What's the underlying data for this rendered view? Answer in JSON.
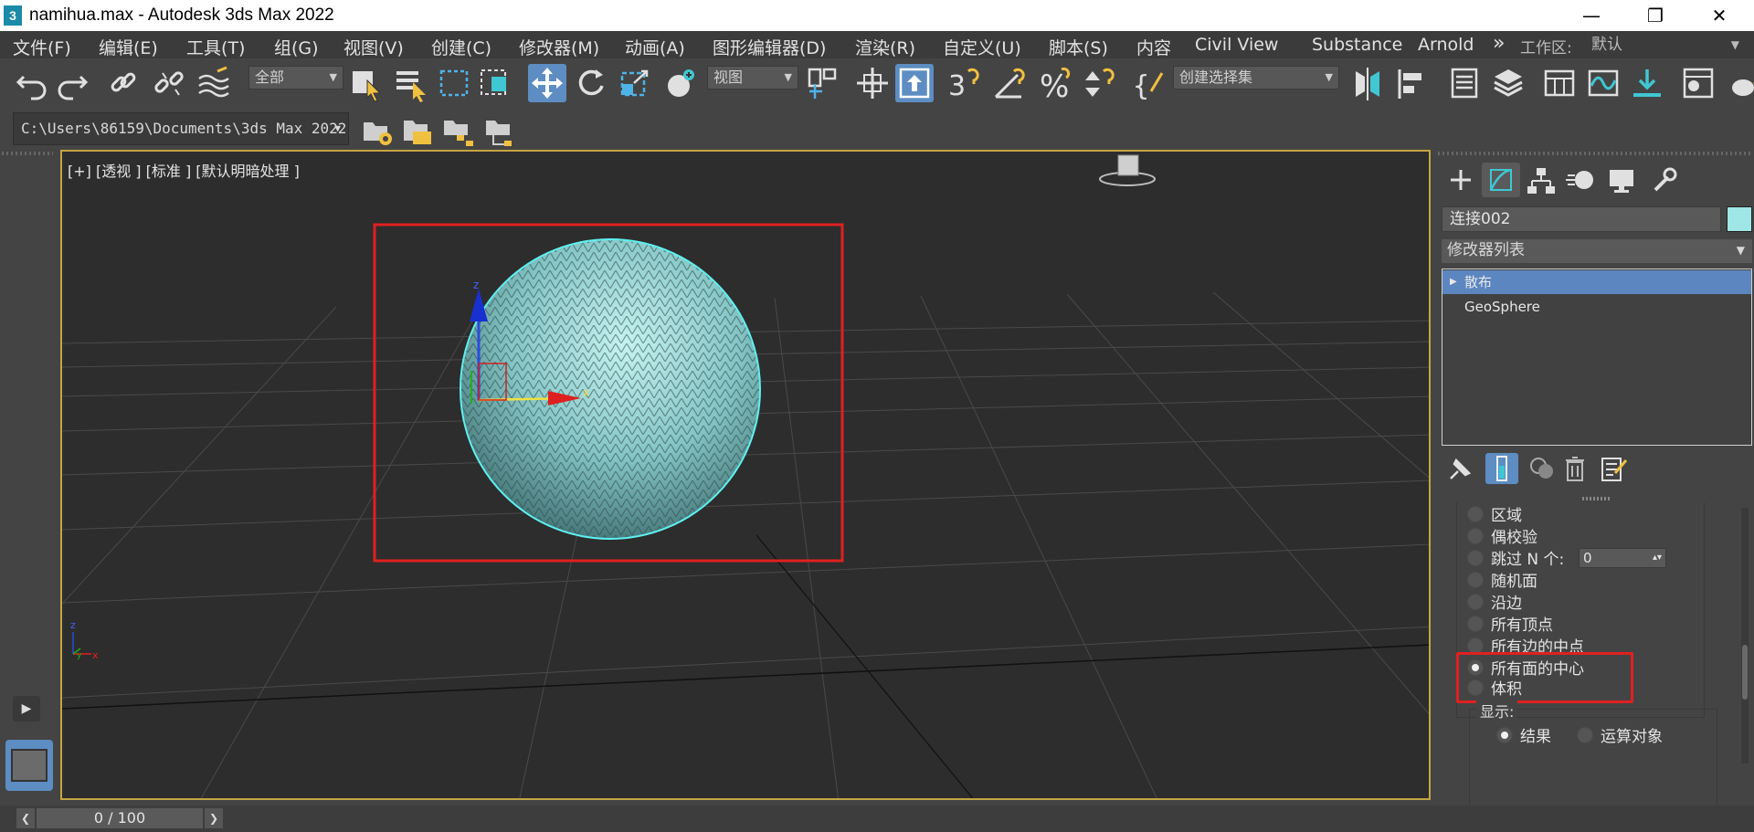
{
  "window": {
    "title": "namihua.max - Autodesk 3ds Max 2022",
    "app_logo": "3",
    "minimize_glyph": "—",
    "maximize_glyph": "❐",
    "close_glyph": "✕"
  },
  "menu": {
    "items": [
      "文件(F)",
      "编辑(E)",
      "工具(T)",
      "组(G)",
      "视图(V)",
      "创建(C)",
      "修改器(M)",
      "动画(A)",
      "图形编辑器(D)",
      "渲染(R)",
      "自定义(U)",
      "脚本(S)",
      "内容",
      "Civil View",
      "Substance",
      "Arnold"
    ],
    "more_glyph": "»",
    "workspace_label": "工作区:",
    "workspace_value": "默认"
  },
  "toolbar": {
    "selection_filter": "全部",
    "reference_coord": "视图",
    "angle_snap_label": "3",
    "named_selection_placeholder": "创建选择集"
  },
  "project_path": "C:\\Users\\86159\\Documents\\3ds Max 2022",
  "viewport": {
    "label": "[+] [透视 ] [标准 ] [默认明暗处理 ]",
    "selected_object_color": "#9fe6e6",
    "highlight_color": "#e02020",
    "axis_x": "x",
    "axis_y": "y",
    "axis_z": "z"
  },
  "command_panel": {
    "object_name": "连接002",
    "object_color": "#9fe6e6",
    "modifier_list_label": "修改器列表",
    "stack": [
      {
        "name": "散布",
        "selected": true
      },
      {
        "name": "GeoSphere",
        "selected": false
      }
    ],
    "distribution_options": [
      {
        "label": "区域",
        "selected": false
      },
      {
        "label": "偶校验",
        "selected": false
      },
      {
        "label": "跳过 N 个:",
        "selected": false
      },
      {
        "label": "随机面",
        "selected": false
      },
      {
        "label": "沿边",
        "selected": false
      },
      {
        "label": "所有顶点",
        "selected": false
      },
      {
        "label": "所有边的中点",
        "selected": false
      },
      {
        "label": "所有面的中心",
        "selected": true
      },
      {
        "label": "体积",
        "selected": false
      }
    ],
    "skip_n_value": "0",
    "display_label": "显示:",
    "display_options": [
      {
        "label": "结果",
        "selected": true
      },
      {
        "label": "运算对象",
        "selected": false
      }
    ]
  },
  "timeline": {
    "frame_display": "0 / 100"
  }
}
